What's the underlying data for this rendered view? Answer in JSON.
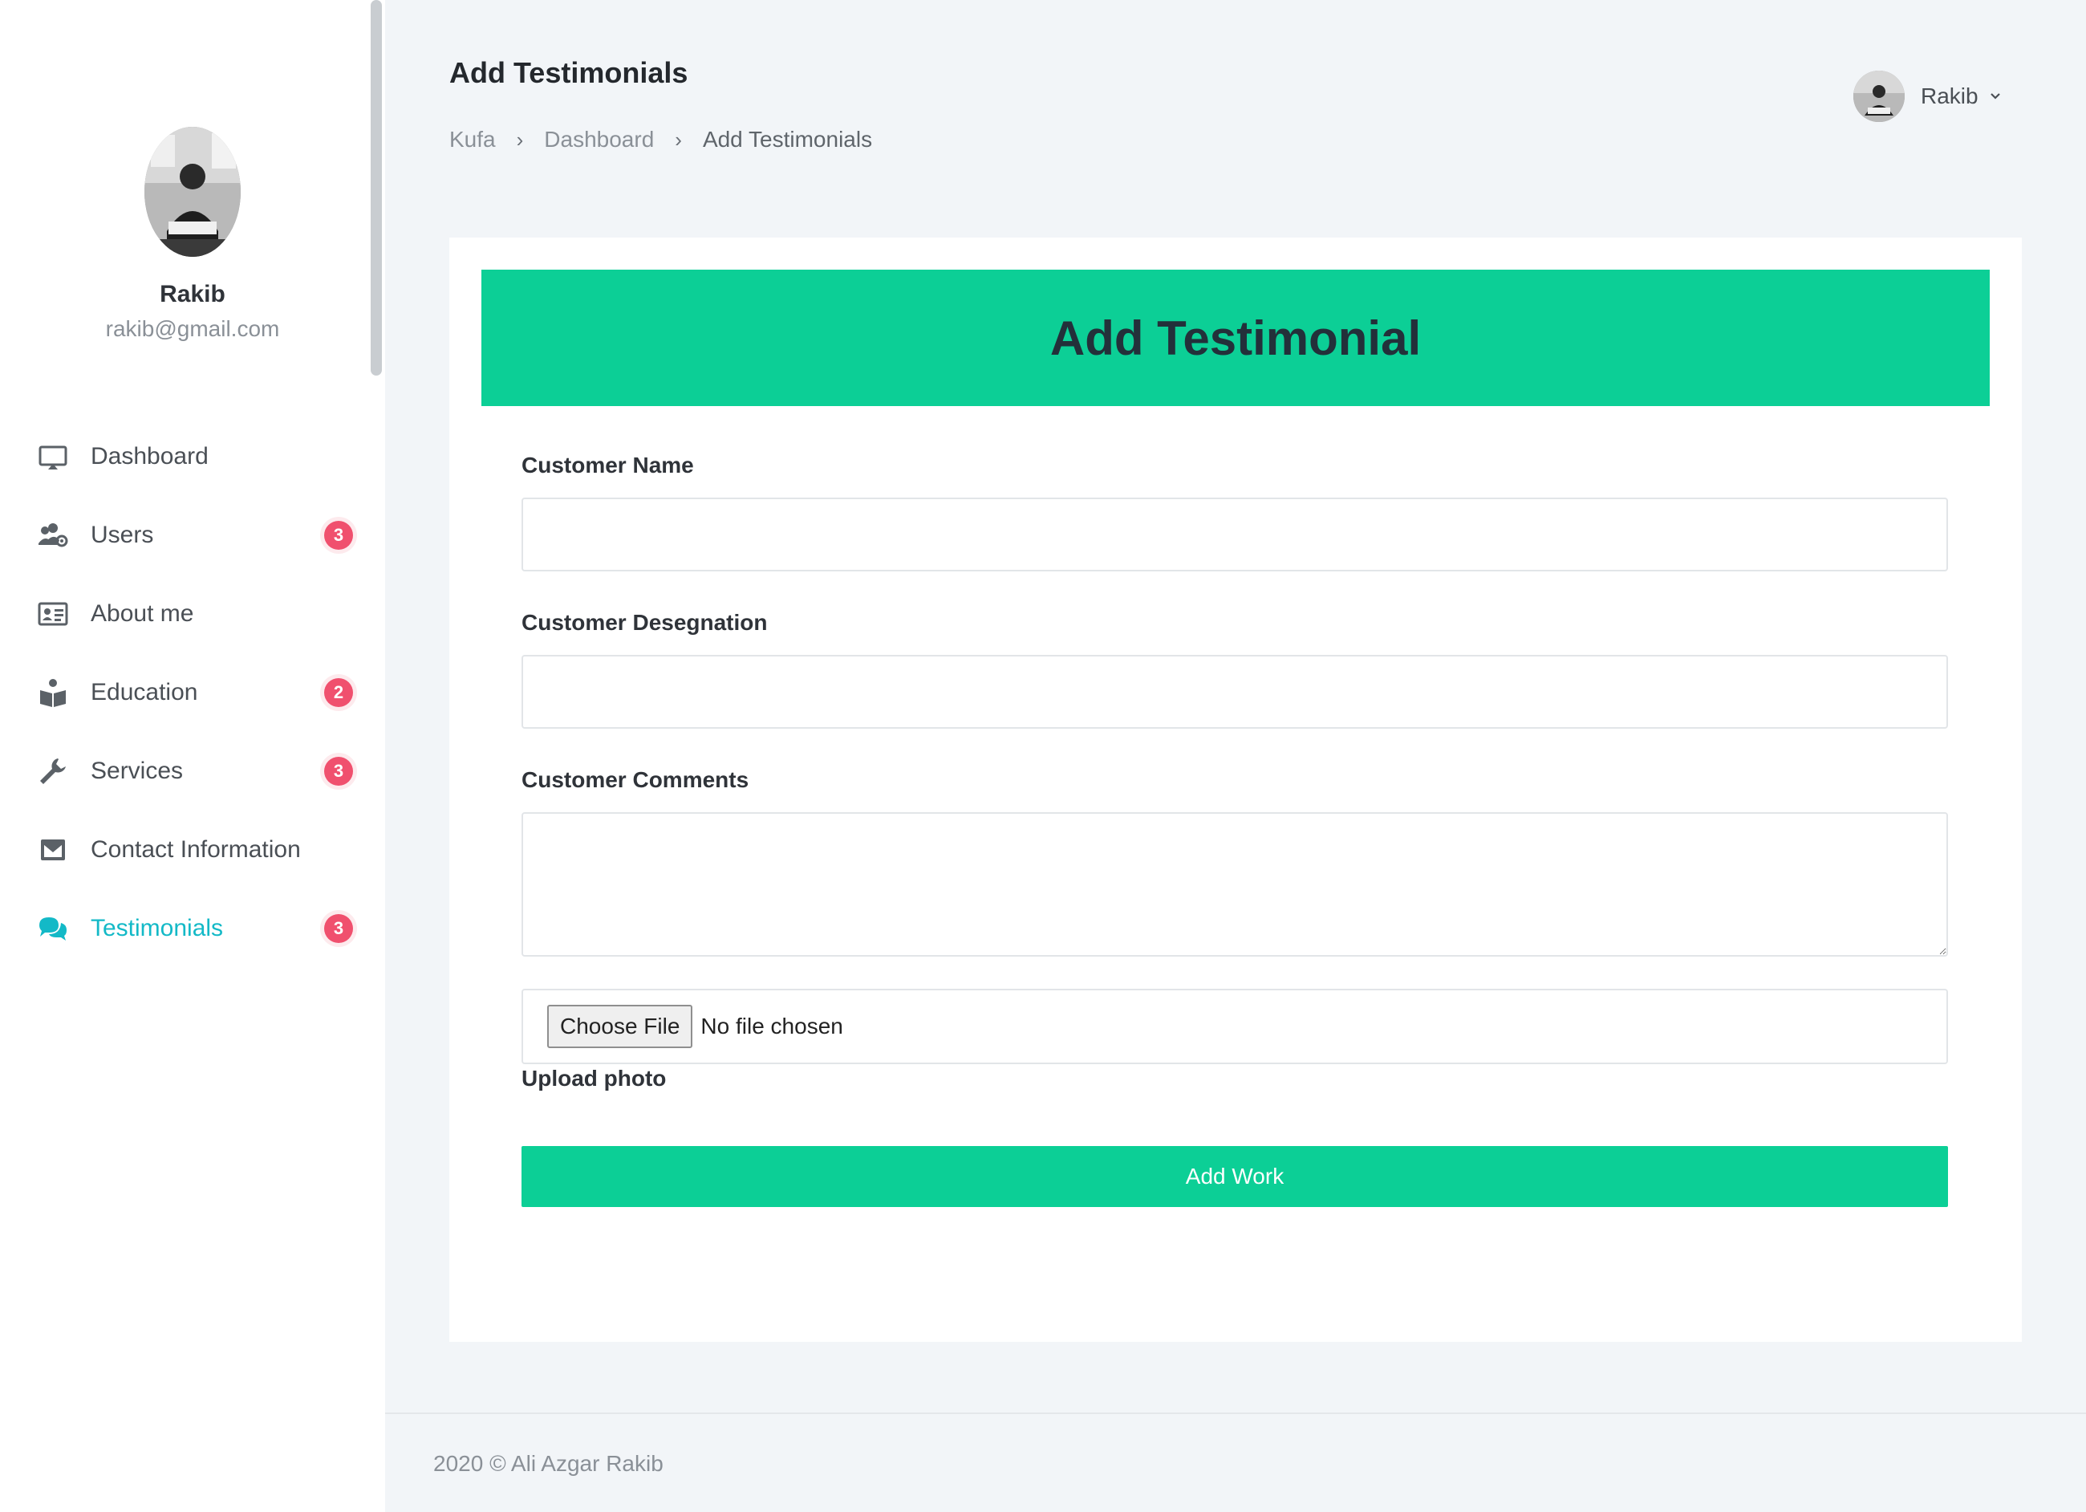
{
  "sidebar": {
    "profile": {
      "name": "Rakib",
      "email": "rakib@gmail.com"
    },
    "items": [
      {
        "label": "Dashboard",
        "icon": "monitor-icon",
        "badge": ""
      },
      {
        "label": "Users",
        "icon": "users-cog-icon",
        "badge": "3"
      },
      {
        "label": "About me",
        "icon": "id-card-icon",
        "badge": ""
      },
      {
        "label": "Education",
        "icon": "book-reader-icon",
        "badge": "2"
      },
      {
        "label": "Services",
        "icon": "wrench-icon",
        "badge": "3"
      },
      {
        "label": "Contact Information",
        "icon": "envelope-icon",
        "badge": ""
      },
      {
        "label": "Testimonials",
        "icon": "comments-icon",
        "badge": "3",
        "active": true
      }
    ]
  },
  "header": {
    "title": "Add Testimonials",
    "breadcrumb": [
      "Kufa",
      "Dashboard",
      "Add Testimonials"
    ],
    "user_name": "Rakib"
  },
  "form": {
    "heading": "Add Testimonial",
    "customer_name_label": "Customer Name",
    "customer_name_value": "",
    "customer_designation_label": "Customer Desegnation",
    "customer_designation_value": "",
    "customer_comments_label": "Customer Comments",
    "customer_comments_value": "",
    "file_button": "Choose File",
    "file_status": "No file chosen",
    "upload_label": "Upload photo",
    "submit_label": "Add Work"
  },
  "footer": {
    "text": "2020 © Ali Azgar Rakib"
  },
  "colors": {
    "accent": "#0ccf96",
    "active_nav": "#13b9c7",
    "badge": "#f0506e",
    "background": "#f2f5f8"
  }
}
